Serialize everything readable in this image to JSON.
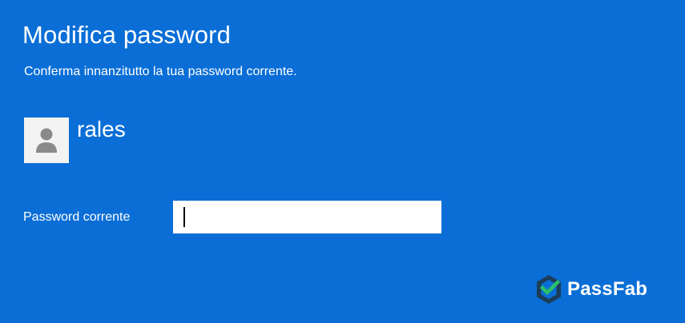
{
  "header": {
    "title": "Modifica password",
    "subtitle": "Conferma innanzitutto la tua password corrente."
  },
  "user": {
    "name": "rales",
    "avatar_icon": "user-silhouette-icon"
  },
  "form": {
    "password_label": "Password corrente",
    "password_value": "",
    "password_placeholder": ""
  },
  "watermark": {
    "text": "PassFab",
    "icon": "passfab-logo-icon"
  },
  "colors": {
    "background": "#0a6ed6",
    "text": "#ffffff",
    "input_background": "#ffffff",
    "avatar_background": "#f3f3f3",
    "avatar_figure": "#8a8a8a",
    "logo_dark": "#1b3d59",
    "logo_green": "#2bbf6a"
  }
}
